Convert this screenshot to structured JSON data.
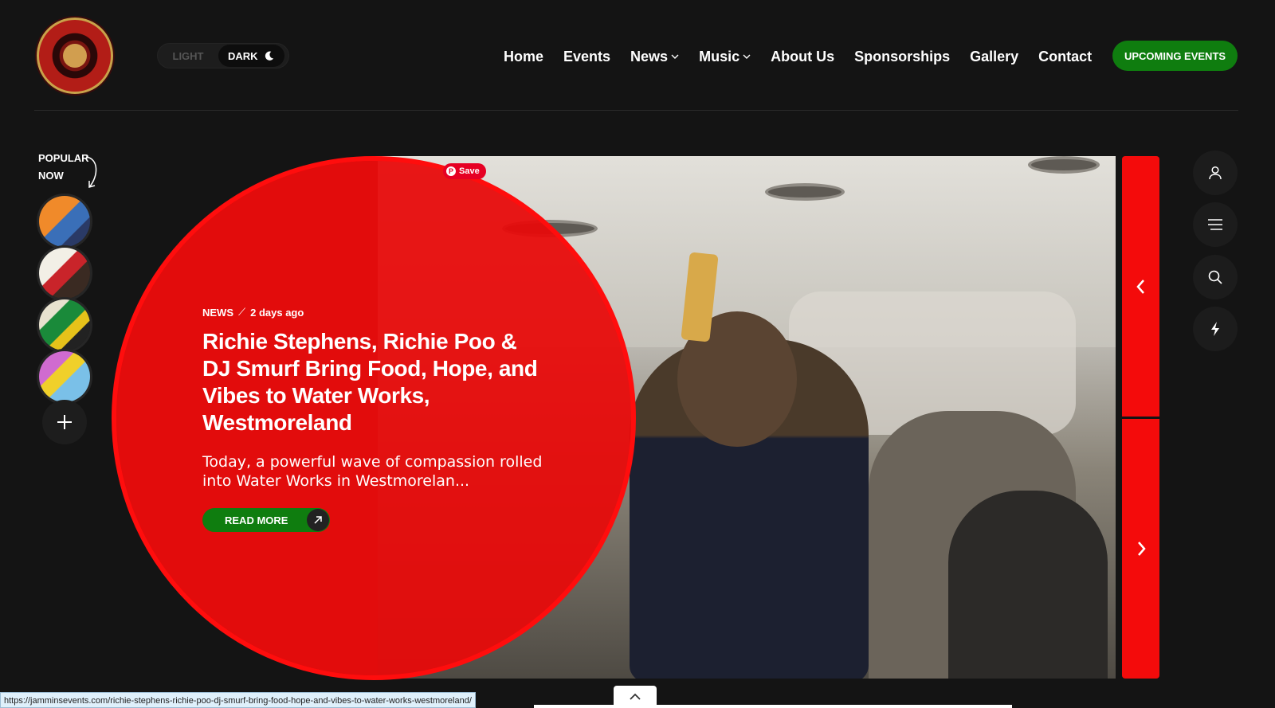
{
  "header": {
    "mode_toggle": {
      "light_label": "LIGHT",
      "dark_label": "DARK"
    },
    "nav": [
      {
        "label": "Home",
        "has_dropdown": false
      },
      {
        "label": "Events",
        "has_dropdown": false
      },
      {
        "label": "News",
        "has_dropdown": true
      },
      {
        "label": "Music",
        "has_dropdown": true
      },
      {
        "label": "About Us",
        "has_dropdown": false
      },
      {
        "label": "Sponsorships",
        "has_dropdown": false
      },
      {
        "label": "Gallery",
        "has_dropdown": false
      },
      {
        "label": "Contact",
        "has_dropdown": false
      }
    ],
    "cta_label": "UPCOMING EVENTS"
  },
  "popular": {
    "label_line1": "POPULAR",
    "label_line2": "NOW"
  },
  "hero": {
    "save_label": "Save",
    "category": "NEWS",
    "meta_separator": "⟋",
    "time_ago": "2 days ago",
    "title": "Richie Stephens, Richie Poo & DJ Smurf Bring Food, Hope, and Vibes to Water Works, Westmoreland",
    "excerpt": "Today, a powerful wave of compassion rolled into Water Works in Westmorelan...",
    "read_more_label": "READ MORE"
  },
  "status_bar": {
    "url": "https://jamminsevents.com/richie-stephens-richie-poo-dj-smurf-bring-food-hope-and-vibes-to-water-works-westmoreland/"
  },
  "colors": {
    "accent_green": "#0f7d0f",
    "accent_red": "#f40b0b",
    "background": "#141414"
  },
  "icons": {
    "side_buttons": [
      "user-icon",
      "menu-icon",
      "search-icon",
      "lightning-icon"
    ]
  }
}
